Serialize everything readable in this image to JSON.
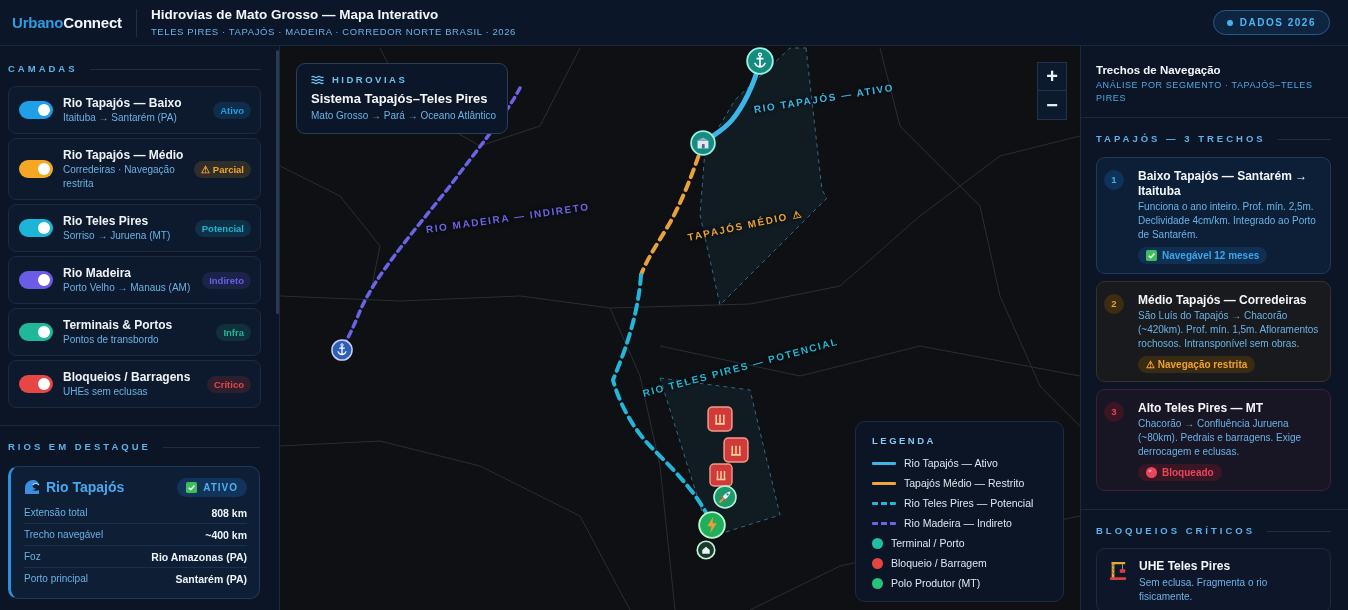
{
  "header": {
    "logo_parts": [
      "Urbano",
      "Connect"
    ],
    "title": "Hidrovias de Mato Grosso — Mapa Interativo",
    "subtitle": "TELES PIRES · TAPAJÓS · MADEIRA · CORREDOR NORTE BRASIL · 2026",
    "badge": "DADOS 2026"
  },
  "layers": {
    "heading": "CAMADAS",
    "items": [
      {
        "title": "Rio Tapajós — Baixo",
        "subtitle": "Itaituba → Santarém (PA)",
        "badge": "Ativo",
        "on": true,
        "color": "#1e9fe8"
      },
      {
        "title": "Rio Tapajós — Médio",
        "subtitle": "Corredeiras · Navegação restrita",
        "badge": "⚠ Parcial",
        "on": true,
        "color": "#f5a623"
      },
      {
        "title": "Rio Teles Pires",
        "subtitle": "Sorriso → Juruena (MT)",
        "badge": "Potencial",
        "on": true,
        "color": "#1cb5d8"
      },
      {
        "title": "Rio Madeira",
        "subtitle": "Porto Velho → Manaus (AM)",
        "badge": "Indireto",
        "on": true,
        "color": "#6b5ce7"
      },
      {
        "title": "Terminais & Portos",
        "subtitle": "Pontos de transbordo",
        "badge": "Infra",
        "on": true,
        "color": "#1fb89a"
      },
      {
        "title": "Bloqueios / Barragens",
        "subtitle": "UHEs sem eclusas",
        "badge": "Crítico",
        "on": true,
        "color": "#e84545"
      }
    ]
  },
  "featured": {
    "heading": "RIOS EM DESTAQUE",
    "title": "Rio Tapajós",
    "status": "ATIVO",
    "rows": [
      {
        "label": "Extensão total",
        "value": "808 km"
      },
      {
        "label": "Trecho navegável",
        "value": "~400 km"
      },
      {
        "label": "Foz",
        "value": "Rio Amazonas (PA)"
      },
      {
        "label": "Porto principal",
        "value": "Santarém (PA)"
      }
    ]
  },
  "map": {
    "info": {
      "kicker": "HIDROVIAS",
      "title": "Sistema Tapajós–Teles Pires",
      "subtitle": "Mato Grosso → Pará → Oceano Atlântico"
    },
    "zoom": [
      "+",
      "−"
    ],
    "routes": [
      {
        "kind": "active",
        "label": "RIO TAPAJÓS — ATIVO"
      },
      {
        "kind": "indirect",
        "label": "RIO MADEIRA — INDIRETO"
      },
      {
        "kind": "restricted",
        "label": "TAPAJÓS MÉDIO ⚠"
      },
      {
        "kind": "potential",
        "label": "RIO TELES PIRES — POTENCIAL"
      }
    ],
    "legend": {
      "title": "LEGENDA",
      "items": [
        {
          "label": "Rio Tapajós — Ativo",
          "kind": "line",
          "color": "#3bb6e6"
        },
        {
          "label": "Tapajós Médio — Restrito",
          "kind": "line",
          "color": "#f2a33a"
        },
        {
          "label": "Rio Teles Pires — Potencial",
          "kind": "dashed",
          "color": "#22b6d8"
        },
        {
          "label": "Rio Madeira — Indireto",
          "kind": "dashed",
          "color": "#6c63e6"
        },
        {
          "label": "Terminal / Porto",
          "kind": "dot",
          "color": "#1fbfa4"
        },
        {
          "label": "Bloqueio / Barragem",
          "kind": "dot",
          "color": "#e5453f"
        },
        {
          "label": "Polo Produtor (MT)",
          "kind": "dot",
          "color": "#25c27a"
        }
      ]
    }
  },
  "segments": {
    "title": "Trechos de Navegação",
    "subtitle": "ANÁLISE POR SEGMENTO · TAPAJÓS–TELES PIRES",
    "heading": "TAPAJÓS — 3 TRECHOS",
    "items": [
      {
        "number": "1",
        "title": "Baixo Tapajós — Santarém → Itaituba",
        "text": "Funciona o ano inteiro. Prof. mín. 2,5m. Declividade 4cm/km. Integrado ao Porto de Santarém.",
        "status": "Navegável 12 meses",
        "kind": "ok"
      },
      {
        "number": "2",
        "title": "Médio Tapajós — Corredeiras",
        "text": "São Luís do Tapajós → Chacorão (~420km). Prof. mín. 1,5m. Afloramentos rochosos. Intransponível sem obras.",
        "status": "⚠ Navegação restrita",
        "kind": "restricted"
      },
      {
        "number": "3",
        "title": "Alto Teles Pires — MT",
        "text": "Chacorão → Confluência Juruena (~80km). Pedrais e barragens. Exige derrocagem e eclusas.",
        "status": "Bloqueado",
        "kind": "blocked"
      }
    ]
  },
  "blocks": {
    "heading": "BLOQUEIOS CRÍTICOS",
    "items": [
      {
        "title": "UHE Teles Pires",
        "text": "Sem eclusa. Fragmenta o rio fisicamente."
      }
    ]
  }
}
